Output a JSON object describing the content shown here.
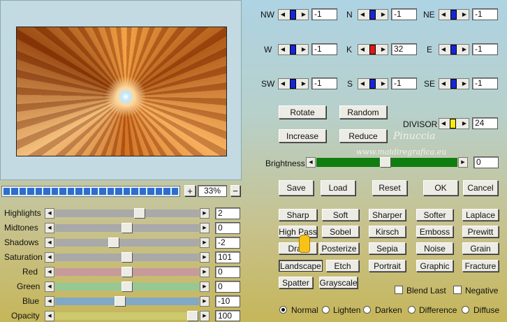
{
  "compass": {
    "nw": {
      "label": "NW",
      "value": "-1"
    },
    "n": {
      "label": "N",
      "value": "-1"
    },
    "ne": {
      "label": "NE",
      "value": "-1"
    },
    "w": {
      "label": "W",
      "value": "-1"
    },
    "k": {
      "label": "K",
      "value": "32"
    },
    "e": {
      "label": "E",
      "value": "-1"
    },
    "sw": {
      "label": "SW",
      "value": "-1"
    },
    "s": {
      "label": "S",
      "value": "-1"
    },
    "se": {
      "label": "SE",
      "value": "-1"
    }
  },
  "actions": {
    "rotate": "Rotate",
    "random": "Random",
    "increase": "Increase",
    "reduce": "Reduce"
  },
  "divisor": {
    "label": "DIVISOR",
    "value": "24"
  },
  "watermark": {
    "line1": "Pinuccia",
    "line2": "www.maidiregrafica.eu"
  },
  "brightness": {
    "label": "Brightness",
    "value": "0"
  },
  "file_buttons": {
    "save": "Save",
    "load": "Load",
    "reset": "Reset",
    "ok": "OK",
    "cancel": "Cancel"
  },
  "zoom": {
    "plus": "+",
    "value": "33%",
    "minus": "−"
  },
  "adjustments": [
    {
      "label": "Highlights",
      "value": "2"
    },
    {
      "label": "Midtones",
      "value": "0"
    },
    {
      "label": "Shadows",
      "value": "-2"
    },
    {
      "label": "Saturation",
      "value": "101"
    },
    {
      "label": "Red",
      "value": "0"
    },
    {
      "label": "Green",
      "value": "0"
    },
    {
      "label": "Blue",
      "value": "-10"
    },
    {
      "label": "Opacity",
      "value": "100"
    }
  ],
  "presets": {
    "sharp": "Sharp",
    "soft": "Soft",
    "sharper": "Sharper",
    "softer": "Softer",
    "laplace": "Laplace",
    "high_pass": "High Pass",
    "sobel": "Sobel",
    "kirsch": "Kirsch",
    "emboss": "Emboss",
    "prewitt": "Prewitt",
    "draw": "Draw",
    "posterize": "Posterize",
    "sepia": "Sepia",
    "noise": "Noise",
    "grain": "Grain",
    "landscape": "Landscape",
    "etch": "Etch",
    "portrait": "Portrait",
    "graphic": "Graphic",
    "fracture": "Fracture",
    "spatter": "Spatter",
    "grayscale": "Grayscale"
  },
  "options": {
    "blend_last": "Blend Last",
    "negative": "Negative"
  },
  "blend_modes": {
    "selected": "Normal",
    "normal": "Normal",
    "lighten": "Lighten",
    "darken": "Darken",
    "difference": "Difference",
    "diffuse": "Diffuse"
  }
}
